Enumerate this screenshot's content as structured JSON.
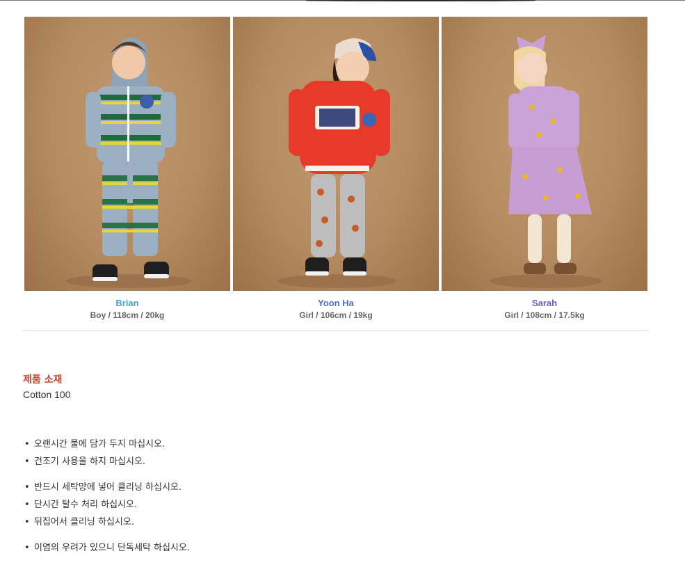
{
  "models": [
    {
      "name": "Brian",
      "spec": "Boy / 118cm / 20kg",
      "name_color": "#3aa6dd"
    },
    {
      "name": "Yoon Ha",
      "spec": "Girl / 106cm / 19kg",
      "name_color": "#4a72d2"
    },
    {
      "name": "Sarah",
      "spec": "Girl / 108cm / 17.5kg",
      "name_color": "#7a55c8"
    }
  ],
  "material": {
    "title": "제품 소재",
    "value": "Cotton 100",
    "title_color": "#d0402e"
  },
  "care": {
    "groups": [
      {
        "items": [
          "오랜시간 물에 담가 두지 마십시오.",
          "건조기 사용을 하지 마십시오."
        ]
      },
      {
        "items": [
          "반드시 세탁망에 넣어 클리닝 하십시오.",
          "단시간 탈수 처리 하십시오.",
          "뒤집어서 클리닝 하십시오."
        ]
      },
      {
        "items": [
          "이염의 우려가 있으니 단독세탁 하십시오."
        ]
      }
    ]
  }
}
